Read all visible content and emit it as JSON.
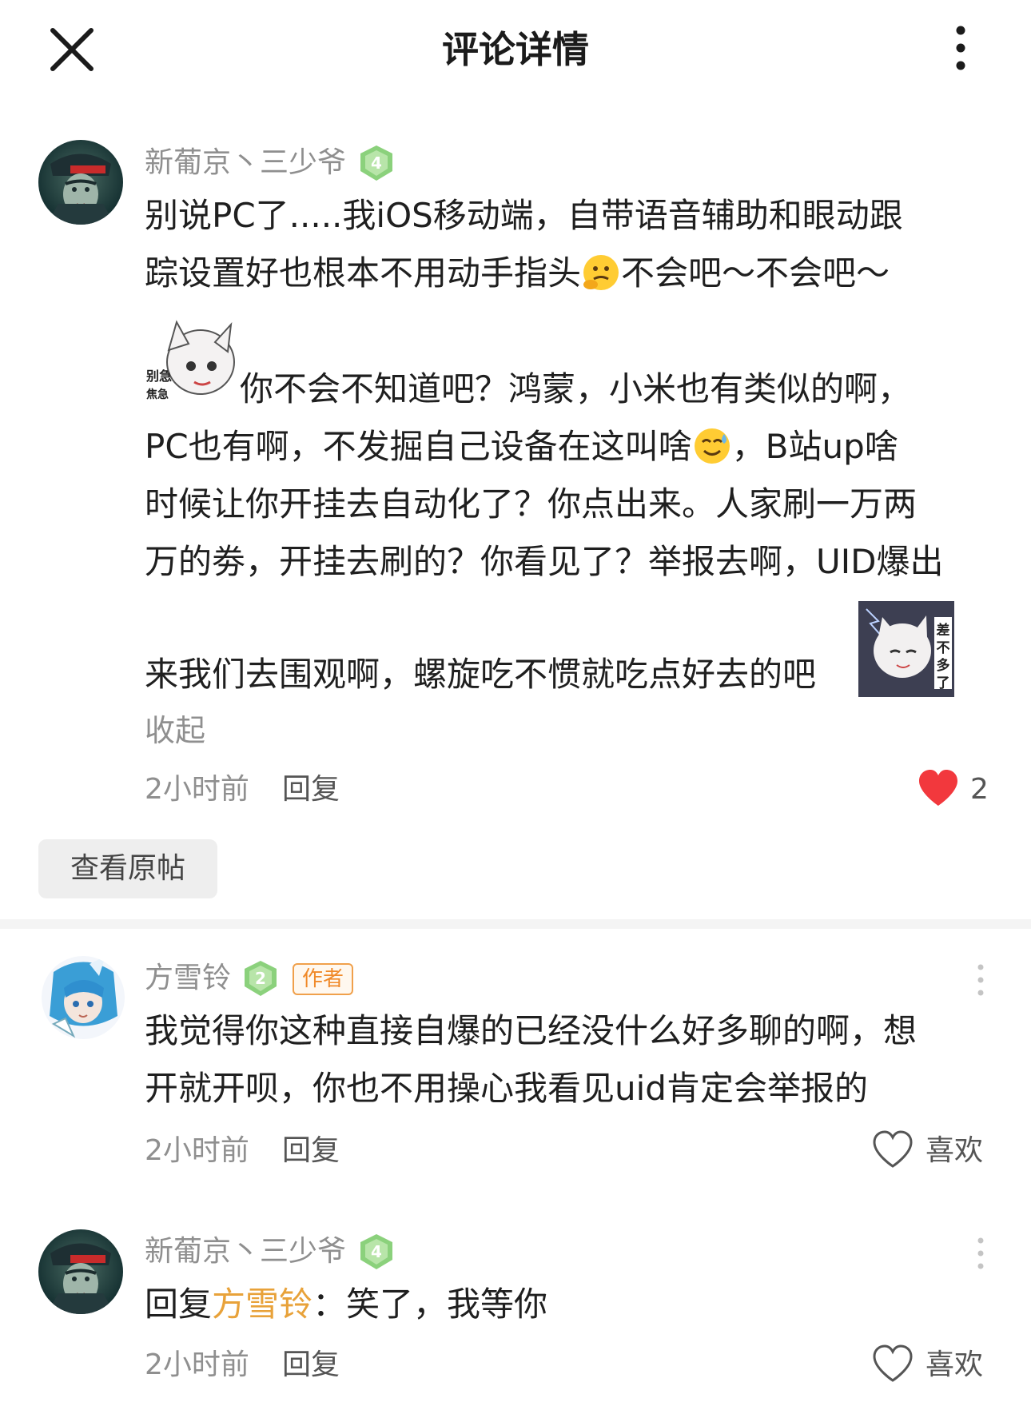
{
  "header": {
    "title": "评论详情",
    "close_icon": "close-icon",
    "more_icon": "more-vertical-icon"
  },
  "main_comment": {
    "username": "新葡京丶三少爷",
    "level": "4",
    "lines": [
      "别说PC了.....我iOS移动端，自带语音辅助和眼动跟",
      "踪设置好也根本不用动手指头",
      "不会吧～不会吧～",
      "你不会不知道吧？鸿蒙，小米也有类似的啊，",
      "PC也有啊，不发掘自己设备在这叫啥",
      "，B站up啥",
      "时候让你开挂去自动化了？你点出来。人家刷一万两",
      "万的劵，开挂去刷的？你看见了？举报去啊，UID爆出",
      "来我们去围观啊，螺旋吃不惯就吃点好去的吧"
    ],
    "sticker1_text": "别急 焦急不急",
    "sticker2_text": "差不多得了",
    "collapse": "收起",
    "time": "2小时前",
    "reply": "回复",
    "like_count": "2",
    "like_active": true,
    "view_post": "查看原帖"
  },
  "replies": [
    {
      "username": "方雪铃",
      "level": "2",
      "author_tag": "作者",
      "lines": [
        "我觉得你这种直接自爆的已经没什么好多聊的啊，想",
        "开就开呗，你也不用操心我看见uid肯定会举报的"
      ],
      "time": "2小时前",
      "reply": "回复",
      "like_label": "喜欢"
    },
    {
      "username": "新葡京丶三少爷",
      "level": "4",
      "reply_prefix": "回复",
      "mention": "方雪铃",
      "text": "：笑了，我等你",
      "time": "2小时前",
      "reply": "回复",
      "like_label": "喜欢"
    }
  ],
  "colors": {
    "accent_heart": "#f2383d",
    "mention": "#e8a23a",
    "level_badge": "#8bd17c",
    "author_tag": "#f08a2a",
    "muted_text": "#8f8f8f"
  }
}
